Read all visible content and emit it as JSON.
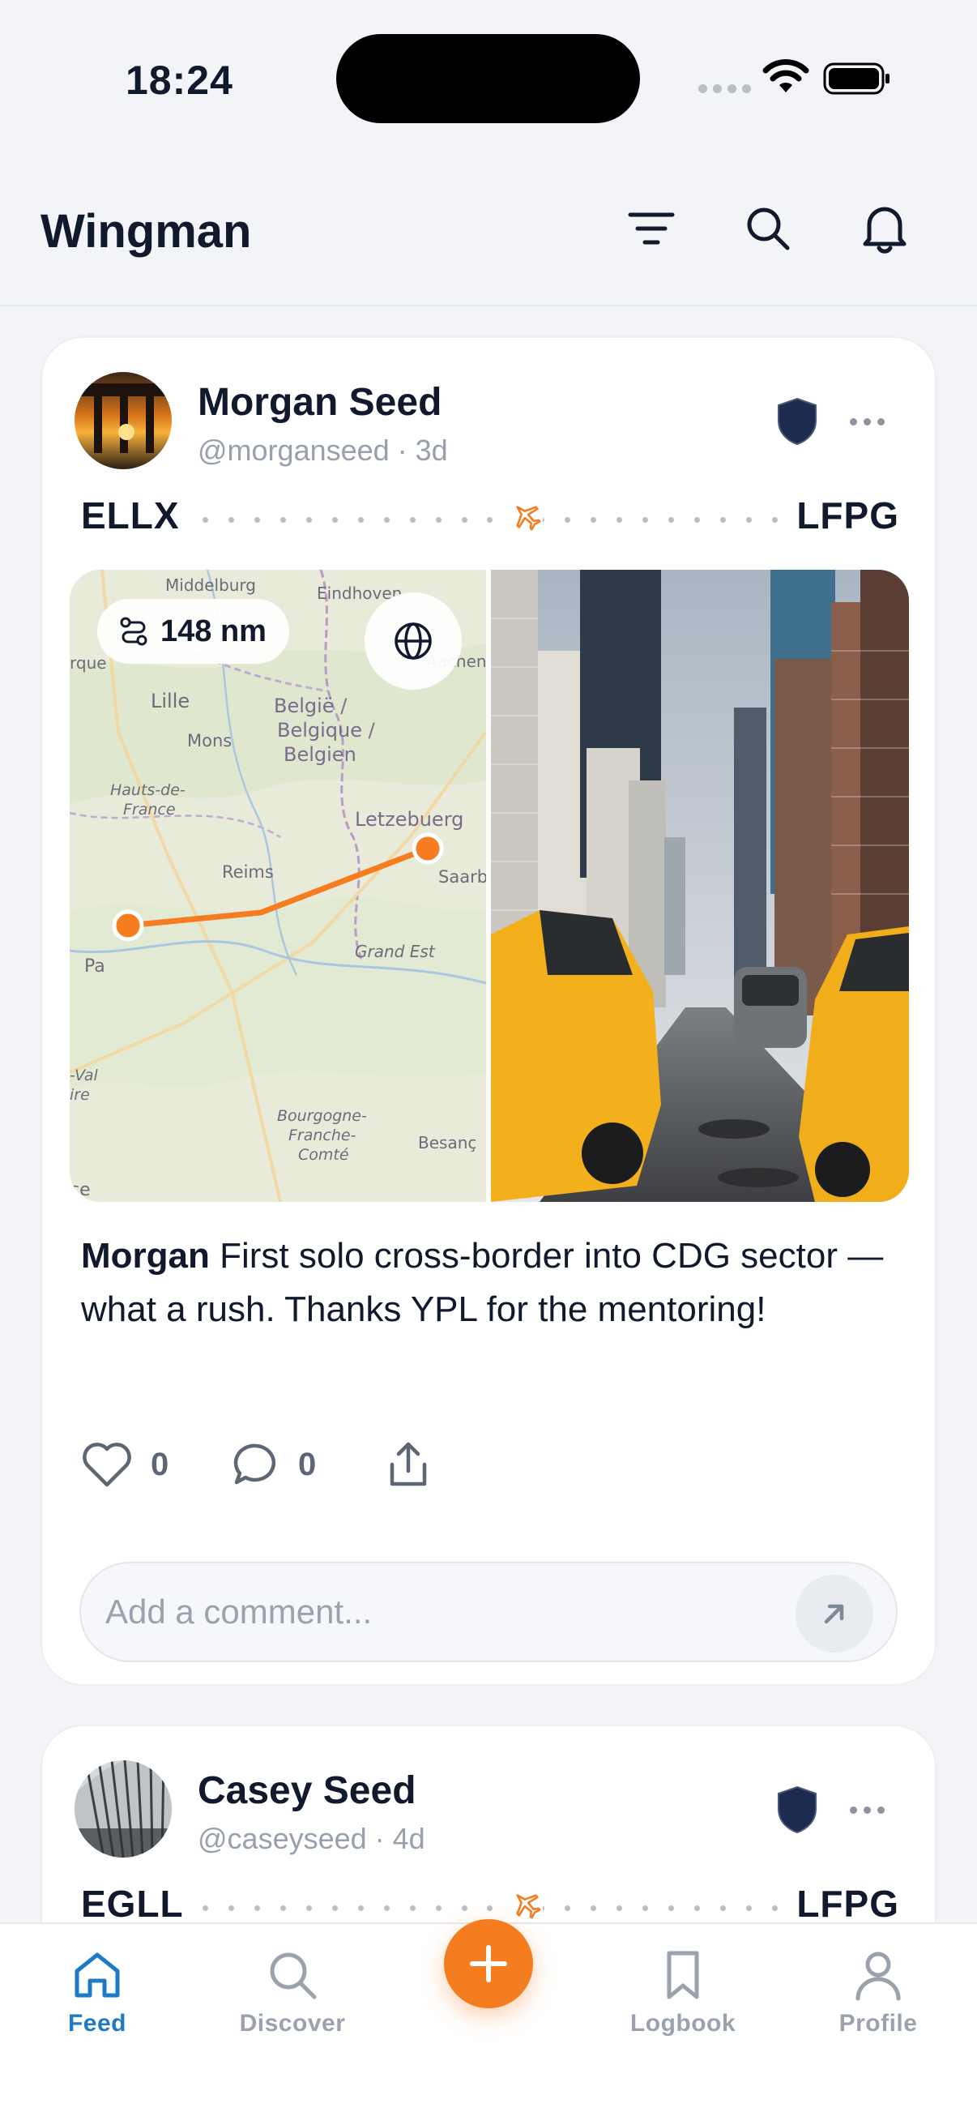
{
  "status_bar": {
    "time": "18:24"
  },
  "header": {
    "title": "Wingman"
  },
  "posts": [
    {
      "author": "Morgan Seed",
      "handle": "@morganseed",
      "age": "3d",
      "meta": "@morganseed · 3d",
      "route": {
        "from": "ELLX",
        "to": "LFPG"
      },
      "distance": "148 nm",
      "map_labels": [
        "Middelburg",
        "Eindhoven",
        "Lille",
        "België / Belgique / Belgien",
        "Mons",
        "Hauts-de-France",
        "Letzebuerg",
        "Reims",
        "Saarb",
        "Grand Est",
        "Pa",
        "Bourgogne-Franche-Comté",
        "Besanç",
        "Aachen",
        "rque",
        "-Val",
        "ire",
        "ce"
      ],
      "caption_author": "Morgan",
      "caption_text": " First solo cross-border into CDG sector — what a rush. Thanks YPL for the mentoring!",
      "likes": "0",
      "comments": "0",
      "comment_placeholder": "Add a comment..."
    },
    {
      "author": "Casey Seed",
      "handle": "@caseyseed",
      "age": "4d",
      "meta": "@caseyseed · 4d",
      "route": {
        "from": "EGLL",
        "to": "LFPG"
      }
    }
  ],
  "tabbar": {
    "tabs": [
      {
        "label": "Feed",
        "icon": "home-icon",
        "active": true
      },
      {
        "label": "Discover",
        "icon": "search-icon",
        "active": false
      },
      {
        "label": "",
        "icon": "plus-icon",
        "active": false
      },
      {
        "label": "Logbook",
        "icon": "bookmark-icon",
        "active": false
      },
      {
        "label": "Profile",
        "icon": "user-icon",
        "active": false
      }
    ]
  },
  "colors": {
    "accent": "#f57c1f",
    "active_tab": "#1f7ac4",
    "text": "#101a2c",
    "muted": "#98a0ac",
    "badge": "#1d2b4f"
  }
}
